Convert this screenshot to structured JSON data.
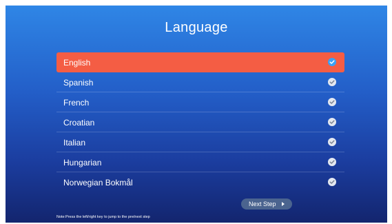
{
  "header": {
    "title": "Language"
  },
  "languages": [
    {
      "label": "English",
      "selected": true
    },
    {
      "label": "Spanish",
      "selected": false
    },
    {
      "label": "French",
      "selected": false
    },
    {
      "label": "Croatian",
      "selected": false
    },
    {
      "label": "Italian",
      "selected": false
    },
    {
      "label": "Hungarian",
      "selected": false
    },
    {
      "label": "Norwegian Bokmål",
      "selected": false
    }
  ],
  "footer": {
    "next_label": "Next Step",
    "note": "Note:Press the left/right key to jump to the pre/next step"
  },
  "icons": {
    "check": "check-circle-icon",
    "next": "play-arrow-icon"
  },
  "colors": {
    "selected_row": "#f45d44",
    "selected_check": "#3aa1f5",
    "unselected_check": "#e4e8f0",
    "button_bg": "#4b648f",
    "background_top": "#2f86e6",
    "background_bottom": "#13256e"
  }
}
